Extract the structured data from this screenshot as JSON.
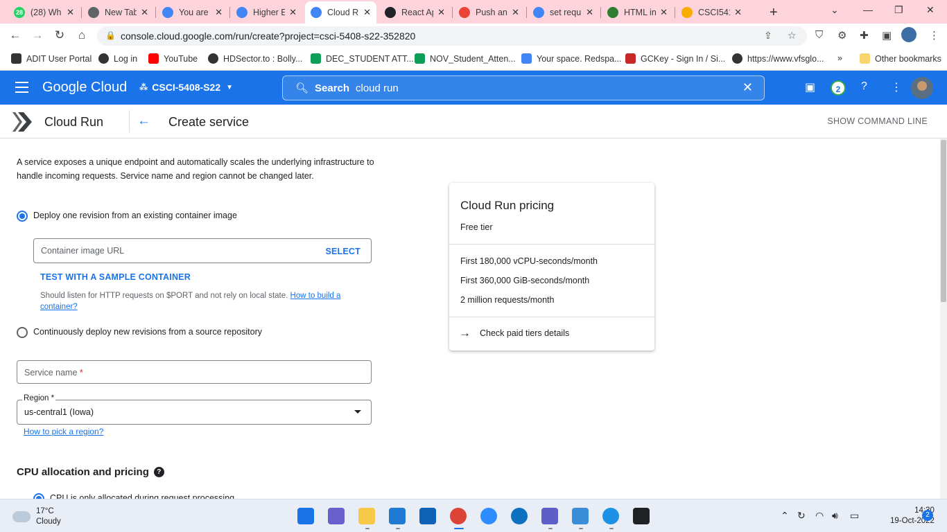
{
  "browser": {
    "tabs": [
      {
        "title": "(28) Wh",
        "color": "#25d366",
        "badge": "28"
      },
      {
        "title": "New Tab",
        "color": "#5f6368",
        "badge": ""
      },
      {
        "title": "You are",
        "color": "#4285f4",
        "badge": ""
      },
      {
        "title": "Higher E",
        "color": "#4285f4",
        "badge": ""
      },
      {
        "title": "Cloud R",
        "color": "#4285f4",
        "badge": ""
      },
      {
        "title": "React Ap",
        "color": "#20232a",
        "badge": ""
      },
      {
        "title": "Push an",
        "color": "#ea4335",
        "badge": ""
      },
      {
        "title": "set requ",
        "color": "#4285f4",
        "badge": ""
      },
      {
        "title": "HTML in",
        "color": "#2e7d32",
        "badge": ""
      },
      {
        "title": "CSCI541",
        "color": "#f9ab00",
        "badge": ""
      }
    ],
    "url": "console.cloud.google.com/run/create?project=csci-5408-s22-352820",
    "bookmarks": [
      {
        "label": "ADIT User Portal",
        "color": "#333"
      },
      {
        "label": "Log in",
        "color": "#333"
      },
      {
        "label": "YouTube",
        "color": "#ff0000"
      },
      {
        "label": "HDSector.to : Bolly...",
        "color": "#333"
      },
      {
        "label": "DEC_STUDENT ATT...",
        "color": "#0f9d58"
      },
      {
        "label": "NOV_Student_Atten...",
        "color": "#0f9d58"
      },
      {
        "label": "Your space. Redspa...",
        "color": "#4285f4"
      },
      {
        "label": "GCKey - Sign In / Si...",
        "color": "#c62828"
      },
      {
        "label": "https://www.vfsglo...",
        "color": "#333"
      }
    ],
    "bookmarks_overflow": "»",
    "other_bookmarks": "Other bookmarks"
  },
  "gcp": {
    "brand": "Google Cloud",
    "project": "CSCI-5408-S22",
    "search_label": "Search",
    "search_value": "cloud run",
    "notification_count": "2"
  },
  "page": {
    "product": "Cloud Run",
    "title": "Create service",
    "show_command_line": "SHOW COMMAND LINE",
    "intro": "A service exposes a unique endpoint and automatically scales the underlying infrastructure to handle incoming requests. Service name and region cannot be changed later.",
    "option_existing": "Deploy one revision from an existing container image",
    "container_placeholder": "Container image URL",
    "select_label": "SELECT",
    "test_sample": "TEST WITH A SAMPLE CONTAINER",
    "hint_text": "Should listen for HTTP requests on $PORT and not rely on local state.",
    "hint_link": "How to build a container?",
    "option_continuous": "Continuously deploy new revisions from a source repository",
    "service_name_placeholder": "Service name",
    "required_mark": "*",
    "region_label": "Region",
    "region_value": "us-central1 (Iowa)",
    "region_help": "How to pick a region?",
    "cpu_section": "CPU allocation and pricing",
    "cpu_option_partial": "CPU is only allocated during request processing"
  },
  "pricing": {
    "title": "Cloud Run pricing",
    "subtitle": "Free tier",
    "items": [
      "First 180,000 vCPU-seconds/month",
      "First 360,000 GiB-seconds/month",
      "2 million requests/month"
    ],
    "paid_link": "Check paid tiers details"
  },
  "taskbar": {
    "temperature": "17°C",
    "weather": "Cloudy",
    "time": "14:30",
    "date": "19-Oct-2022",
    "notifications": "2"
  }
}
